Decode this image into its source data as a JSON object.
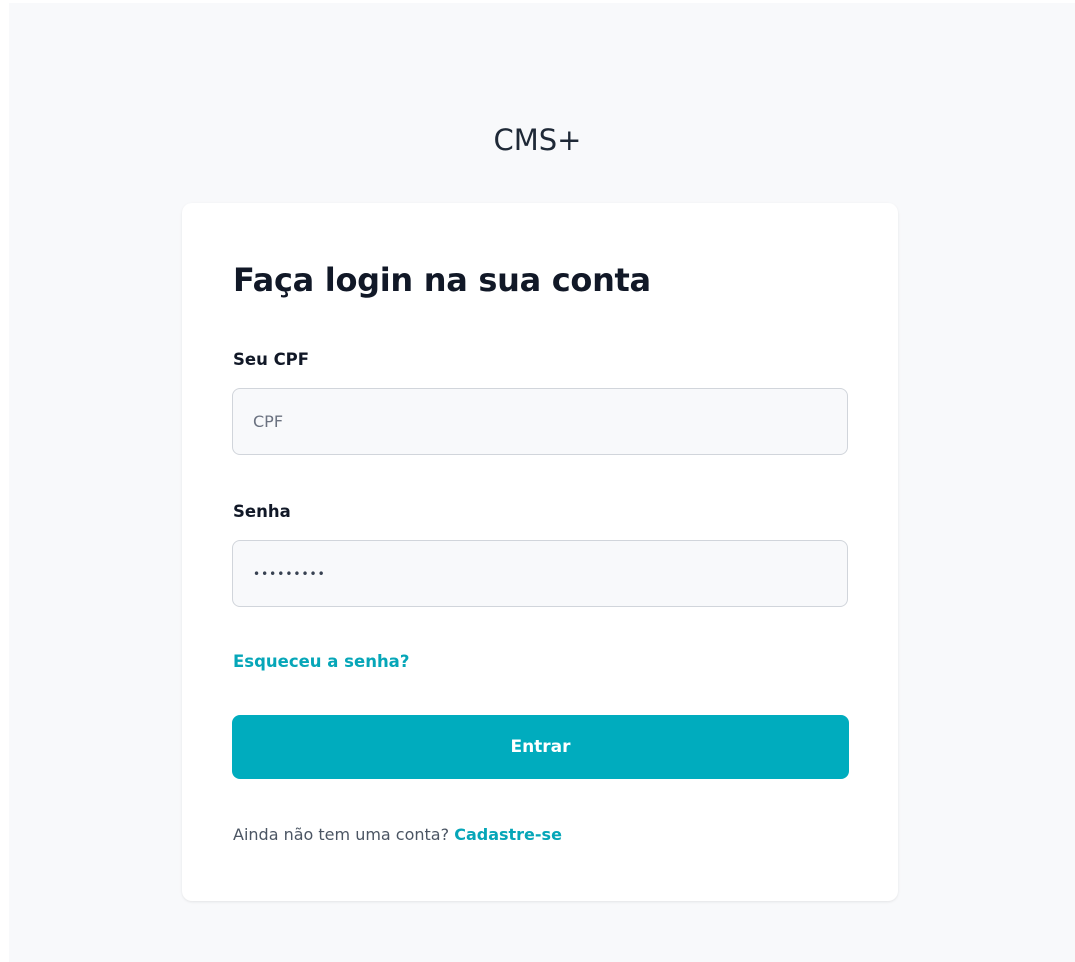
{
  "app": {
    "title": "CMS+"
  },
  "login": {
    "heading": "Faça login na sua conta",
    "cpf_label": "Seu CPF",
    "cpf_placeholder": "CPF",
    "cpf_value": "",
    "password_label": "Senha",
    "password_value": "•••••••••",
    "forgot_password": "Esqueceu a senha?",
    "submit_label": "Entrar",
    "signup_prompt": "Ainda não tem uma conta?",
    "signup_link": "Cadastre-se"
  },
  "colors": {
    "accent": "#00acbe",
    "link": "#06a6b8",
    "page_background": "#f8f9fb",
    "card_background": "#ffffff"
  }
}
